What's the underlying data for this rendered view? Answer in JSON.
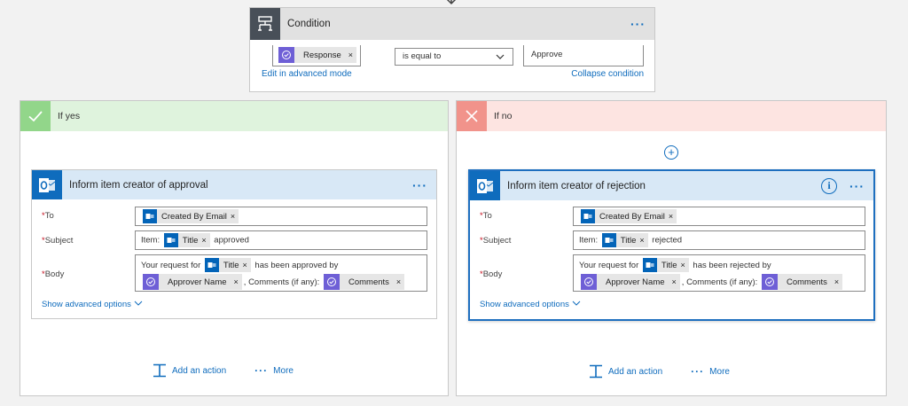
{
  "condition": {
    "title": "Condition",
    "left_token": "Response",
    "operator": "is equal to",
    "value": "Approve",
    "edit_link": "Edit in advanced mode",
    "collapse_link": "Collapse condition"
  },
  "branches": {
    "yes": {
      "label": "If yes",
      "action": {
        "title": "Inform item creator of approval",
        "to_label": "To",
        "to_token": "Created By Email",
        "subject_label": "Subject",
        "subject_prefix": "Item:",
        "subject_token": "Title",
        "subject_suffix": "approved",
        "body_label": "Body",
        "body_text1": "Your request for",
        "body_token_title": "Title",
        "body_text2": "has been approved by",
        "body_token_approver": "Approver Name",
        "body_text3": ", Comments (if any):",
        "body_token_comments": "Comments",
        "advanced": "Show advanced options"
      },
      "add_action": "Add an action",
      "more": "More"
    },
    "no": {
      "label": "If no",
      "action": {
        "title": "Inform item creator of rejection",
        "to_label": "To",
        "to_token": "Created By Email",
        "subject_label": "Subject",
        "subject_prefix": "Item:",
        "subject_token": "Title",
        "subject_suffix": "rejected",
        "body_label": "Body",
        "body_text1": "Your request for",
        "body_token_title": "Title",
        "body_text2": "has been rejected by",
        "body_token_approver": "Approver Name",
        "body_text3": ", Comments (if any):",
        "body_token_comments": "Comments",
        "advanced": "Show advanced options"
      },
      "add_action": "Add an action",
      "more": "More"
    }
  },
  "required_marker": "*",
  "token_remove": "×",
  "colors": {
    "accent": "#0f6cbd",
    "yes_header": "#dff3dd",
    "no_header": "#fde4e1",
    "approval_token": "#6e5fd6",
    "sharepoint_token": "#0364b8"
  }
}
